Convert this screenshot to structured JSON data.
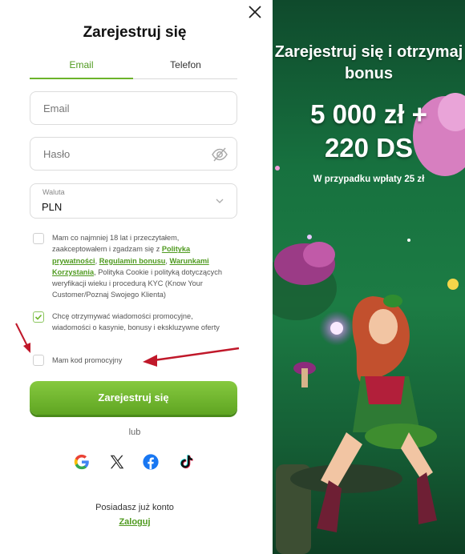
{
  "form": {
    "title": "Zarejestruj się",
    "tabs": [
      "Email",
      "Telefon"
    ],
    "email_placeholder": "Email",
    "password_placeholder": "Hasło",
    "currency_label": "Waluta",
    "currency_value": "PLN",
    "terms": {
      "prefix": "Mam co najmniej 18 lat i przeczytałem, zaakceptowałem i zgadzam się z",
      "link1": "Polityka prywatności",
      "sep1": ",",
      "link2": "Regulamin bonusu",
      "sep2": ",",
      "link3": "Warunkami Korzystania",
      "suffix": ", Polityka Cookie i polityką dotyczących weryfikacji wieku i procedurą KYC (Know Your Customer/Poznaj Swojego Klienta)"
    },
    "promo_consent": "Chcę otrzymywać wiadomości promocyjne, wiadomości o kasynie, bonusy i ekskluzywne oferty",
    "promo_code": "Mam kod promocyjny",
    "submit": "Zarejestruj się",
    "or": "lub",
    "have_account": "Posiadasz już konto",
    "login": "Zaloguj"
  },
  "checkboxes": {
    "terms_checked": false,
    "promo_checked": true,
    "code_checked": false
  },
  "social_icons": [
    "google-icon",
    "x-icon",
    "facebook-icon",
    "tiktok-icon"
  ],
  "promo": {
    "headline": "Zarejestruj się i otrzymaj bonus",
    "amount_line1": "5 000 zł +",
    "amount_line2": "220 DS",
    "note": "W przypadku wpłaty 25 zł"
  },
  "colors": {
    "accent": "#6cb42a",
    "button": "#5fa522",
    "arrow": "#c0182a",
    "promo_bg": "#17713f"
  }
}
